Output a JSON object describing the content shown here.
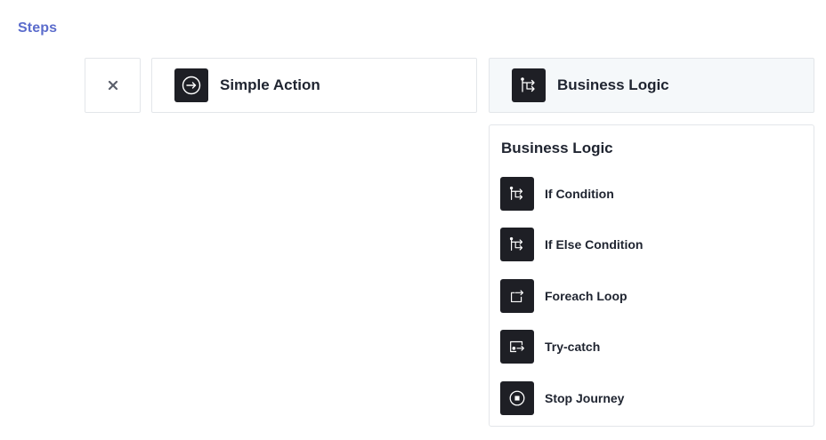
{
  "section": {
    "title": "Steps"
  },
  "step_types": {
    "simple": {
      "label": "Simple Action",
      "icon": "arrow-circle-icon"
    },
    "logic": {
      "label": "Business Logic",
      "icon": "branch-icon",
      "selected": true
    }
  },
  "dropdown": {
    "title": "Business Logic",
    "items": [
      {
        "label": "If Condition",
        "icon": "branch-icon"
      },
      {
        "label": "If Else Condition",
        "icon": "branch-icon"
      },
      {
        "label": "Foreach Loop",
        "icon": "loop-icon"
      },
      {
        "label": "Try-catch",
        "icon": "try-catch-icon"
      },
      {
        "label": "Stop Journey",
        "icon": "stop-icon"
      }
    ]
  },
  "colors": {
    "accent": "#5b6ccc",
    "icon_bg": "#1e1f25",
    "selected_bg": "#f5f8fa",
    "border": "#e3e6ea"
  }
}
